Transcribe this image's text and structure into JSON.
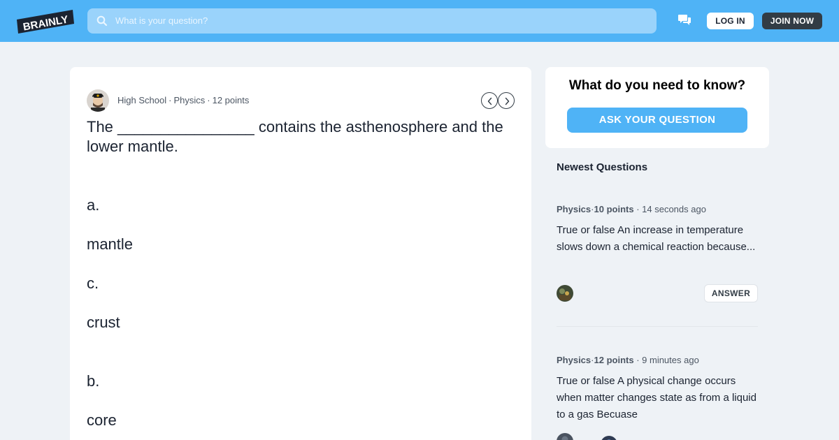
{
  "header": {
    "logo_text": "BRAINLY",
    "search_placeholder": "What is your question?",
    "icons": {
      "search": "search-icon",
      "messages": "chat-bubble-icon"
    },
    "login_label": "LOG IN",
    "join_label": "JOIN NOW",
    "colors": {
      "bar": "#4fb3f6",
      "join_bg": "#323c45"
    }
  },
  "question": {
    "level": "High School",
    "subject": "Physics",
    "points": "12 points",
    "separator": "·",
    "text": "The ________________ contains the asthenosphere and the lower mantle.",
    "options": [
      {
        "letter": "a.",
        "answer": "mantle"
      },
      {
        "letter": "c.",
        "answer": "crust"
      },
      {
        "letter": "b.",
        "answer": "core"
      }
    ],
    "prev_icon": "chevron-left-icon",
    "next_icon": "chevron-right-icon"
  },
  "ask": {
    "title": "What do you need to know?",
    "button_label": "ASK YOUR QUESTION"
  },
  "newest": {
    "heading": "Newest Questions",
    "items": [
      {
        "subject": "Physics",
        "points": "10 points",
        "time": "· 14 seconds ago",
        "text": "True or false An increase in temperature slows down a chemical reaction because...",
        "answer_label": "ANSWER"
      },
      {
        "subject": "Physics",
        "points": "12 points",
        "time": "· 9 minutes ago",
        "text": "True or false A physical change occurs when matter changes state as from a liquid to a gas Becuase"
      }
    ]
  }
}
